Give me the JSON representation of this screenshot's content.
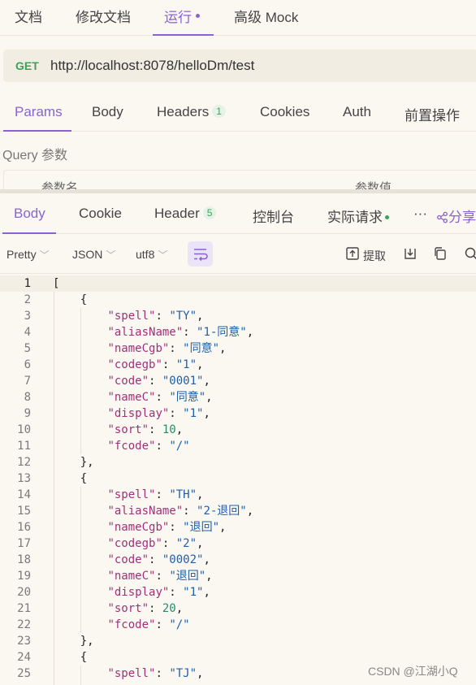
{
  "top_tabs": [
    {
      "label": "文档"
    },
    {
      "label": "修改文档"
    },
    {
      "label": "运行"
    },
    {
      "label": "高级 Mock"
    }
  ],
  "request": {
    "method": "GET",
    "url": "http://localhost:8078/helloDm/test"
  },
  "request_tabs": [
    {
      "label": "Params"
    },
    {
      "label": "Body"
    },
    {
      "label": "Headers",
      "badge": "1"
    },
    {
      "label": "Cookies"
    },
    {
      "label": "Auth"
    },
    {
      "label": "前置操作"
    }
  ],
  "query": {
    "title": "Query 参数",
    "col_name": "参数名",
    "col_value": "参数值"
  },
  "response_tabs": [
    {
      "label": "Body"
    },
    {
      "label": "Cookie"
    },
    {
      "label": "Header",
      "badge": "5"
    },
    {
      "label": "控制台"
    },
    {
      "label": "实际请求"
    },
    {
      "label": "···"
    },
    {
      "label": "分享"
    }
  ],
  "toolbar": {
    "format": "Pretty",
    "type": "JSON",
    "encoding": "utf8",
    "extract": "提取"
  },
  "icons": {
    "wrap": "wrap-lines-icon",
    "extract": "extract-icon",
    "download": "download-icon",
    "copy": "copy-icon",
    "search": "search-icon",
    "share": "share-icon"
  },
  "colors": {
    "accent": "#8a63d2",
    "method_get": "#3aa35a",
    "json_key": "#a0307a",
    "json_string": "#1f5fa8",
    "json_number": "#2a8a6a"
  },
  "code_lines": [
    "[",
    "    {",
    "        \"spell\": \"TY\",",
    "        \"aliasName\": \"1-同意\",",
    "        \"nameCgb\": \"同意\",",
    "        \"codegb\": \"1\",",
    "        \"code\": \"0001\",",
    "        \"nameC\": \"同意\",",
    "        \"display\": \"1\",",
    "        \"sort\": 10,",
    "        \"fcode\": \"/\"",
    "    },",
    "    {",
    "        \"spell\": \"TH\",",
    "        \"aliasName\": \"2-退回\",",
    "        \"nameCgb\": \"退回\",",
    "        \"codegb\": \"2\",",
    "        \"code\": \"0002\",",
    "        \"nameC\": \"退回\",",
    "        \"display\": \"1\",",
    "        \"sort\": 20,",
    "        \"fcode\": \"/\"",
    "    },",
    "    {",
    "        \"spell\": \"TJ\","
  ],
  "watermark": "CSDN @江湖小Q"
}
